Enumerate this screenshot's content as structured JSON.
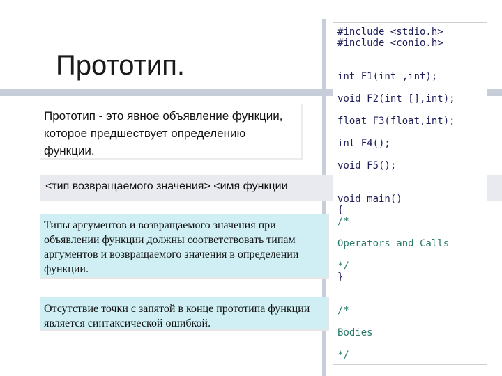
{
  "slide": {
    "title": "Прототип.",
    "definition": "Прототип - это явное объявление функции, которое предшествует определению функции.",
    "syntax": "<тип возвращаемого значения> <имя функции",
    "note1": "Типы аргументов и возвращаемого значения при объявлении функции должны соответствовать типам аргументов и  возвращаемого значения в определении функции.",
    "note2": "Отсутствие точки с запятой в конце прототипа функции является синтаксической ошибкой."
  },
  "code": {
    "include1": "#include <stdio.h>",
    "include2": "#include <conio.h>",
    "f1": "int F1(int ,int);",
    "f2": "void F2(int [],int);",
    "f3": "float F3(float,int);",
    "f4": "int F4();",
    "f5": "void F5();",
    "main": "void main()",
    "open_brace": "{",
    "comment_open1": "/*",
    "operators": "Operators and Calls",
    "comment_close1": "*/",
    "close_brace": "}",
    "comment_open2": "/*",
    "bodies": "Bodies",
    "comment_close2": "*/"
  },
  "colors": {
    "code_dark": "#1e1e5a",
    "code_comment": "#2a7a6a",
    "note_background": "#cfeff4",
    "accent_bar": "#c7ced9"
  }
}
